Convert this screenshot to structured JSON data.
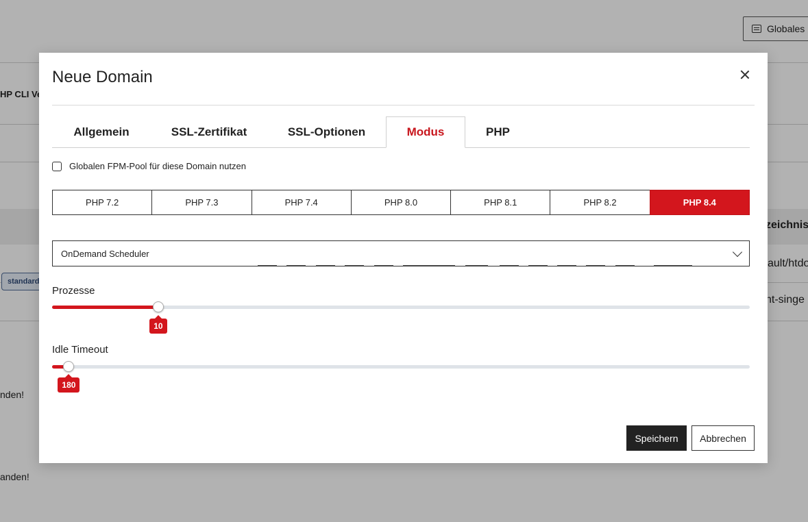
{
  "background": {
    "global_button_label": "Globales",
    "php_cli_header": "HP CLI Ve",
    "directory_header": "zeichnis",
    "row_path_1": "ault/htdo",
    "row_path_2": "nt-singe",
    "badge": "standard",
    "notice_1": "nden!",
    "notice_2": "anden!"
  },
  "modal": {
    "title": "Neue Domain",
    "tabs": [
      {
        "label": "Allgemein",
        "active": false
      },
      {
        "label": "SSL-Zertifikat",
        "active": false
      },
      {
        "label": "SSL-Optionen",
        "active": false
      },
      {
        "label": "Modus",
        "active": true
      },
      {
        "label": "PHP",
        "active": false
      }
    ],
    "checkbox_label": "Globalen FPM-Pool für diese Domain nutzen",
    "checkbox_checked": false,
    "php_versions": [
      "PHP 7.2",
      "PHP 7.3",
      "PHP 7.4",
      "PHP 8.0",
      "PHP 8.1",
      "PHP 8.2",
      "PHP 8.4"
    ],
    "php_selected": "PHP 8.4",
    "scheduler_value": "OnDemand Scheduler",
    "sliders": {
      "processes": {
        "label": "Prozesse",
        "value": "10",
        "fraction": 0.152
      },
      "idle_timeout": {
        "label": "Idle Timeout",
        "value": "180",
        "fraction": 0.024
      }
    },
    "save_label": "Speichern",
    "cancel_label": "Abbrechen"
  },
  "colors": {
    "accent": "#d3161d",
    "dark": "#222222",
    "track": "#dfe3e8"
  }
}
